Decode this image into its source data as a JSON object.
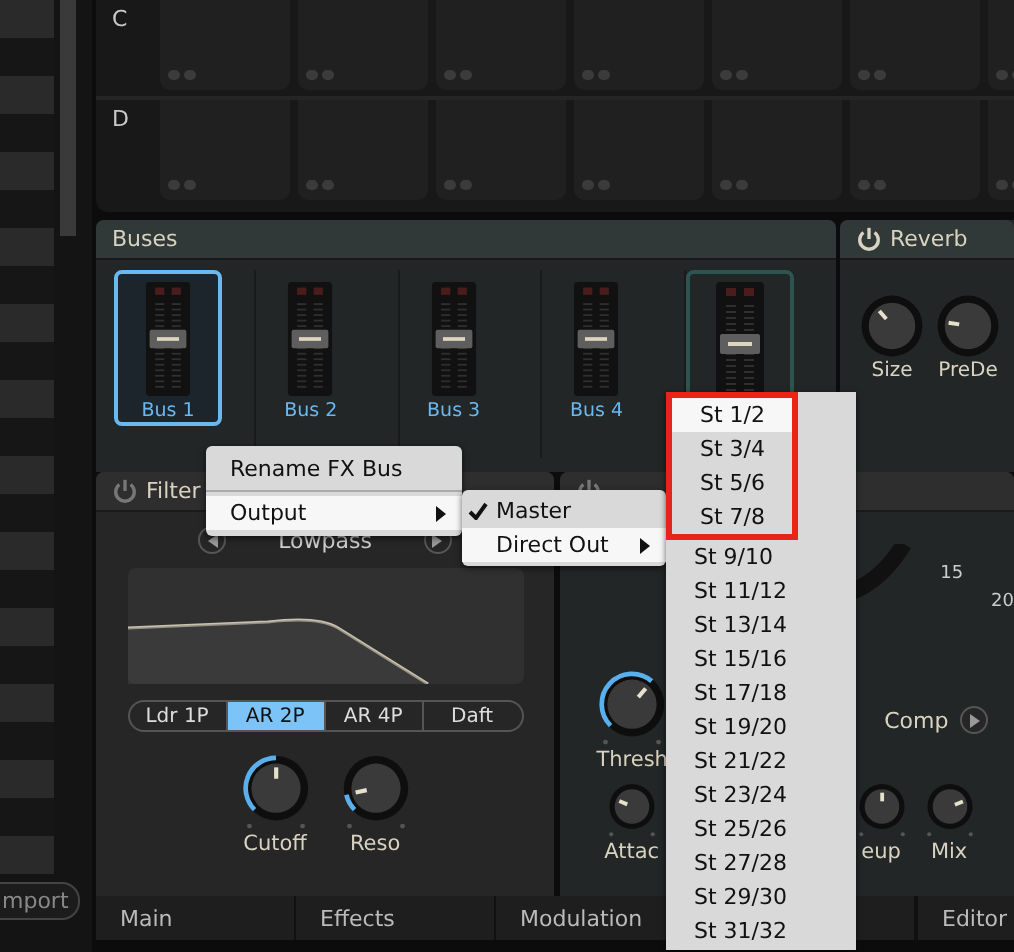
{
  "pad_rows": [
    {
      "label": "C"
    },
    {
      "label": "D"
    }
  ],
  "sidebar": {
    "import_button": "mport"
  },
  "buses": {
    "title": "Buses",
    "channels": [
      {
        "label": "Bus 1",
        "selected": true,
        "outlined": false,
        "level": 0.5
      },
      {
        "label": "Bus 2",
        "selected": false,
        "outlined": false,
        "level": 0.5
      },
      {
        "label": "Bus 3",
        "selected": false,
        "outlined": false,
        "level": 0.5
      },
      {
        "label": "Bus 4",
        "selected": false,
        "outlined": false,
        "level": 0.5
      },
      {
        "selected": false,
        "outlined": true,
        "level": 0.5
      }
    ]
  },
  "reverb": {
    "title": "Reverb",
    "power": true,
    "knobs": [
      {
        "label": "Size",
        "level": 0.35,
        "active": false
      },
      {
        "label": "PreDe",
        "level": 0.2,
        "active": false
      }
    ]
  },
  "filter": {
    "title": "Filter",
    "power": false,
    "type": "Lowpass",
    "modes": [
      {
        "label": "Ldr 1P",
        "selected": false
      },
      {
        "label": "AR 2P",
        "selected": true
      },
      {
        "label": "AR 4P",
        "selected": false
      },
      {
        "label": "Daft",
        "selected": false
      }
    ],
    "knobs": [
      {
        "label": "Cutoff",
        "level": 0.5,
        "active": true
      },
      {
        "label": "Reso",
        "level": 0.12,
        "active": true
      }
    ]
  },
  "comp": {
    "power": false,
    "scale_labels": [
      "15",
      "20"
    ],
    "thresh": {
      "label": "Thresh",
      "level": 0.65,
      "active": true
    },
    "mode_label": "Comp",
    "small_knobs": [
      {
        "label": "Attac",
        "level": 0.25,
        "active": false
      },
      {
        "label": "eup",
        "level": 0.5,
        "active": false
      },
      {
        "label": "Mix",
        "level": 0.75,
        "active": false
      }
    ]
  },
  "bottom_tabs": [
    "Main",
    "Effects",
    "Modulation",
    "Editor"
  ],
  "context_menu": {
    "items": [
      {
        "kind": "item",
        "label": "Rename FX Bus",
        "highlighted": false,
        "submenu": false
      },
      {
        "kind": "separator"
      },
      {
        "kind": "item",
        "label": "Output",
        "highlighted": true,
        "submenu": true
      }
    ]
  },
  "output_menu": {
    "items": [
      {
        "label": "Master",
        "checked": true,
        "highlighted": false,
        "submenu": false
      },
      {
        "label": "Direct Out",
        "checked": false,
        "highlighted": true,
        "submenu": true
      }
    ]
  },
  "direct_out_menu": {
    "annotation": {
      "kind": "box"
    },
    "items": [
      {
        "label": "St 1/2",
        "highlighted": true,
        "marked": true
      },
      {
        "label": "St 3/4",
        "highlighted": false,
        "marked": true
      },
      {
        "label": "St 5/6",
        "highlighted": false,
        "marked": true
      },
      {
        "label": "St 7/8",
        "highlighted": false,
        "marked": true
      },
      {
        "label": "St 9/10",
        "highlighted": false,
        "marked": false
      },
      {
        "label": "St 11/12",
        "highlighted": false,
        "marked": false
      },
      {
        "label": "St 13/14",
        "highlighted": false,
        "marked": false
      },
      {
        "label": "St 15/16",
        "highlighted": false,
        "marked": false
      },
      {
        "label": "St 17/18",
        "highlighted": false,
        "marked": false
      },
      {
        "label": "St 19/20",
        "highlighted": false,
        "marked": false
      },
      {
        "label": "St 21/22",
        "highlighted": false,
        "marked": false
      },
      {
        "label": "St 23/24",
        "highlighted": false,
        "marked": false
      },
      {
        "label": "St 25/26",
        "highlighted": false,
        "marked": false
      },
      {
        "label": "St 27/28",
        "highlighted": false,
        "marked": false
      },
      {
        "label": "St 29/30",
        "highlighted": false,
        "marked": false
      },
      {
        "label": "St 31/32",
        "highlighted": false,
        "marked": false
      }
    ]
  }
}
